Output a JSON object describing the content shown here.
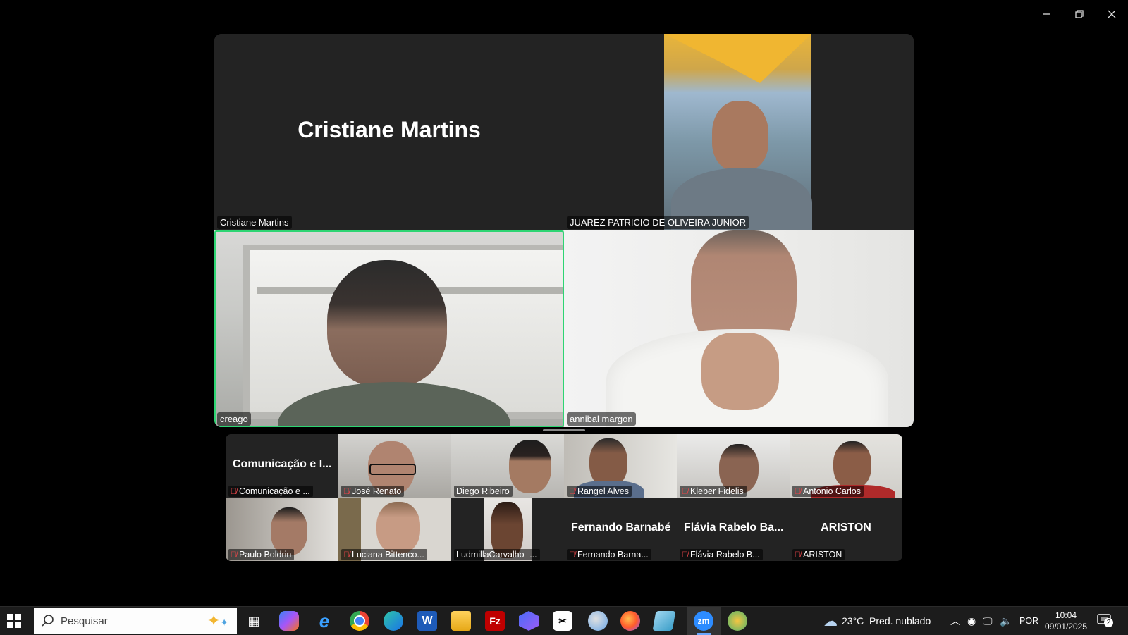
{
  "window": {
    "minimize": "—",
    "restore": "❐",
    "close": "✕"
  },
  "main_grid": {
    "top_left": {
      "name": "Cristiane Martins",
      "display_name": "Cristiane Martins"
    },
    "top_right": {
      "name": "JUAREZ PATRICIO DE OLIVEIRA JUNIOR"
    },
    "bottom_left": {
      "name": "creago"
    },
    "bottom_right": {
      "name": "annibal margon"
    }
  },
  "thumbnails": [
    {
      "label": "Comunicação e ...",
      "display": "Comunicação e I...",
      "muted": true
    },
    {
      "label": "José Renato",
      "muted": true
    },
    {
      "label": "Diego Ribeiro",
      "muted": false
    },
    {
      "label": "Rangel Alves",
      "muted": true
    },
    {
      "label": "Kleber Fidelis",
      "muted": true
    },
    {
      "label": "Antonio Carlos",
      "muted": true
    },
    {
      "label": "Paulo Boldrin",
      "muted": true
    },
    {
      "label": "Luciana Bittenco...",
      "muted": true
    },
    {
      "label": "LudmillaCarvalho- ...",
      "muted": false
    },
    {
      "label": "Fernando Barna...",
      "display": "Fernando Barnabé",
      "muted": true
    },
    {
      "label": "Flávia Rabelo B...",
      "display": "Flávia Rabelo Ba...",
      "muted": true
    },
    {
      "label": "ARISTON",
      "display": "ARISTON",
      "muted": true
    }
  ],
  "taskbar": {
    "search_placeholder": "Pesquisar",
    "weather": "23°C  Pred. nublado",
    "language": "POR",
    "time": "10:04",
    "date": "09/01/2025",
    "notifications": "2",
    "zoom_label": "zm",
    "filezilla_label": "Fz",
    "word_label": "W",
    "edge_legacy_label": "e"
  },
  "colors": {
    "active_speaker": "#2ed573",
    "muted": "#e8464a",
    "taskbar": "#1c1c1c"
  }
}
